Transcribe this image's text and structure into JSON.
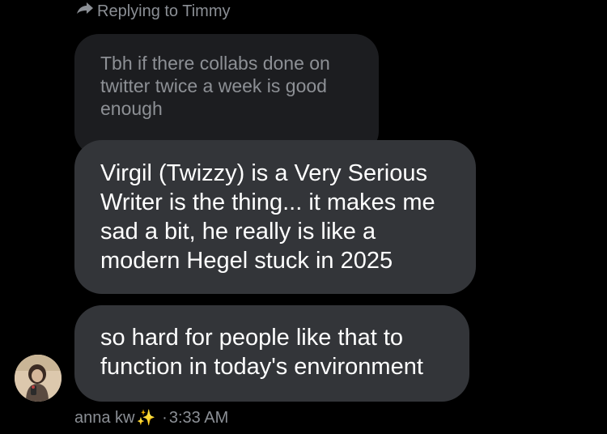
{
  "reply_header": {
    "icon": "reply-arrow-icon",
    "text": "Replying to Timmy"
  },
  "quoted_message": {
    "text": "Tbh if there collabs done on twitter twice a week is good enough"
  },
  "messages": [
    {
      "text": "Virgil (Twizzy) is a Very Serious Writer is the thing... it makes me sad a bit, he really is like a modern Hegel stuck in 2025"
    },
    {
      "text": "so hard for people like that to function in today's environment"
    }
  ],
  "sender": {
    "name": "anna kw",
    "emoji": "✨",
    "separator": "·",
    "time": "3:33 AM",
    "avatar": "user-avatar"
  },
  "colors": {
    "background": "#000000",
    "bubble": "#333539",
    "quoted_bubble": "#1c1d20",
    "muted_text": "#8b8f95",
    "sparkle": "#f7c934"
  }
}
